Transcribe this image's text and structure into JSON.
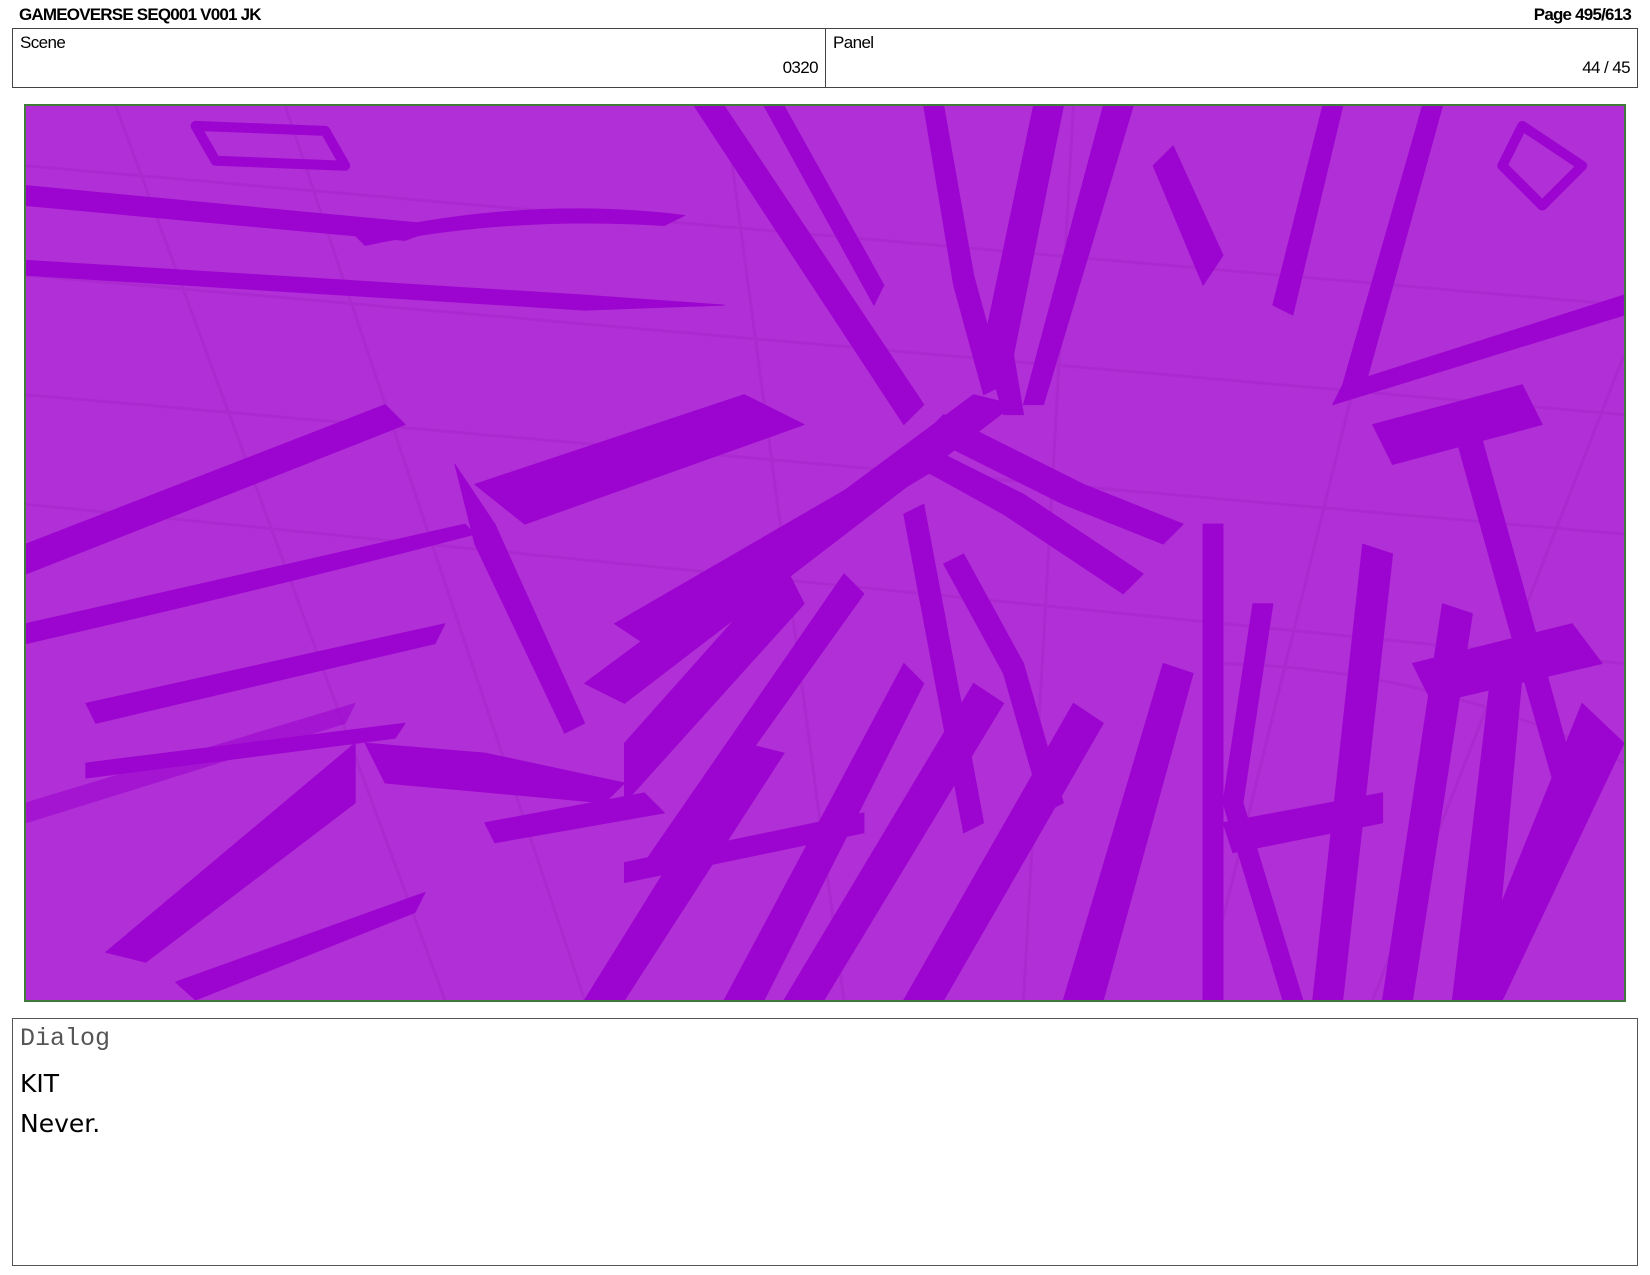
{
  "header": {
    "title": "GAMEOVERSE SEQ001 V001 JK",
    "page": "Page 495/613"
  },
  "info": {
    "scene_label": "Scene",
    "scene_value": "0320",
    "panel_label": "Panel",
    "panel_value": "44 / 45"
  },
  "panel_image": {
    "description_icon": "sketch-drawing",
    "background_color": "#b12fd6",
    "stroke_color": "#9c05d0",
    "grid_color": "#a828cc"
  },
  "dialog": {
    "label": "Dialog",
    "character": "KIT",
    "line": "Never."
  }
}
